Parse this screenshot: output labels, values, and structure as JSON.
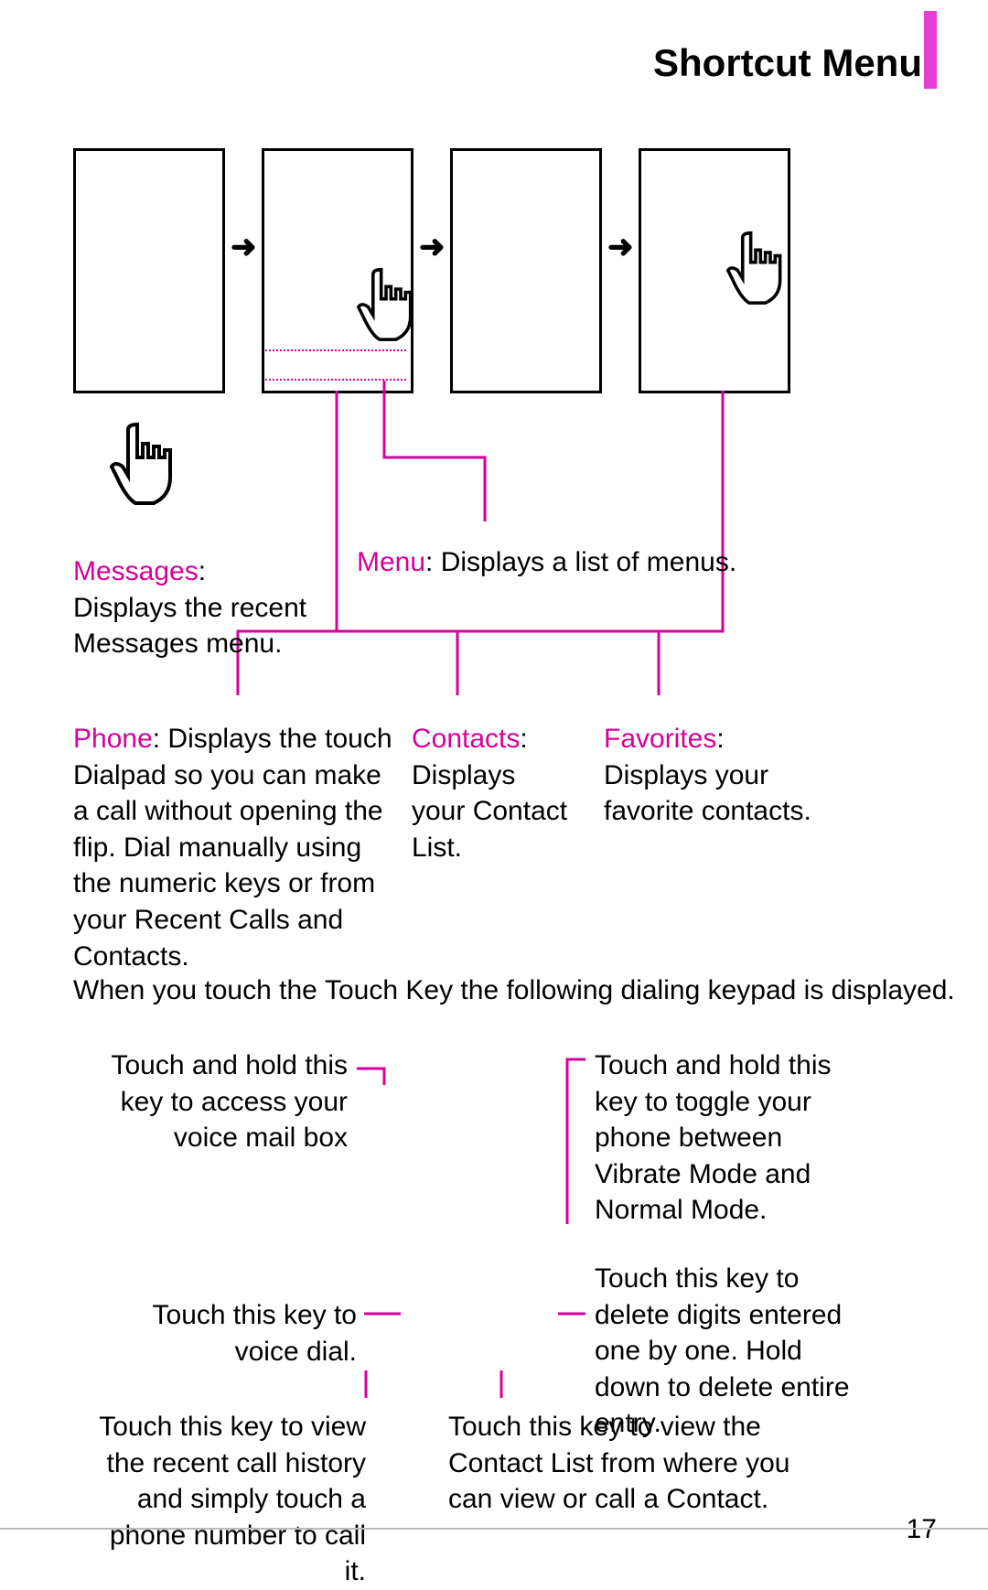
{
  "header": {
    "title": "Shortcut Menu"
  },
  "menu_caption": {
    "label": "Menu",
    "sep": ": ",
    "desc": "Displays a list of menus."
  },
  "messages_caption": {
    "label": "Messages",
    "sep": ": ",
    "desc": "Displays the recent Messages menu."
  },
  "phone_caption": {
    "label": "Phone",
    "sep": ": ",
    "desc": "Displays the touch Dialpad so you can make a call without opening the flip. Dial manually using the numeric keys or from your Recent Calls and Contacts."
  },
  "contacts_caption": {
    "label": "Contacts",
    "sep": ":",
    "desc": "Displays your Contact List."
  },
  "favorites_caption": {
    "label": "Favorites",
    "sep": ": ",
    "desc": "Displays your favorite contacts."
  },
  "touchkey_sentence": {
    "part1": "When you touch the",
    "part2": "Touch Key the following dialing keypad is displayed."
  },
  "keypad": {
    "voicemail": "Touch and hold this key to access your voice mail box",
    "vibrate": "Touch and hold this key to toggle your phone between Vibrate Mode and Normal Mode.",
    "voice_dial": "Touch this key to voice dial.",
    "delete": "Touch this key to delete digits entered one by one. Hold down to delete entire entry.",
    "recent": "Touch this key to view the recent call history and simply touch a phone number to call it.",
    "contact_list": "Touch this key to view the Contact List from where you can view or call a Contact."
  },
  "page_number": "17"
}
